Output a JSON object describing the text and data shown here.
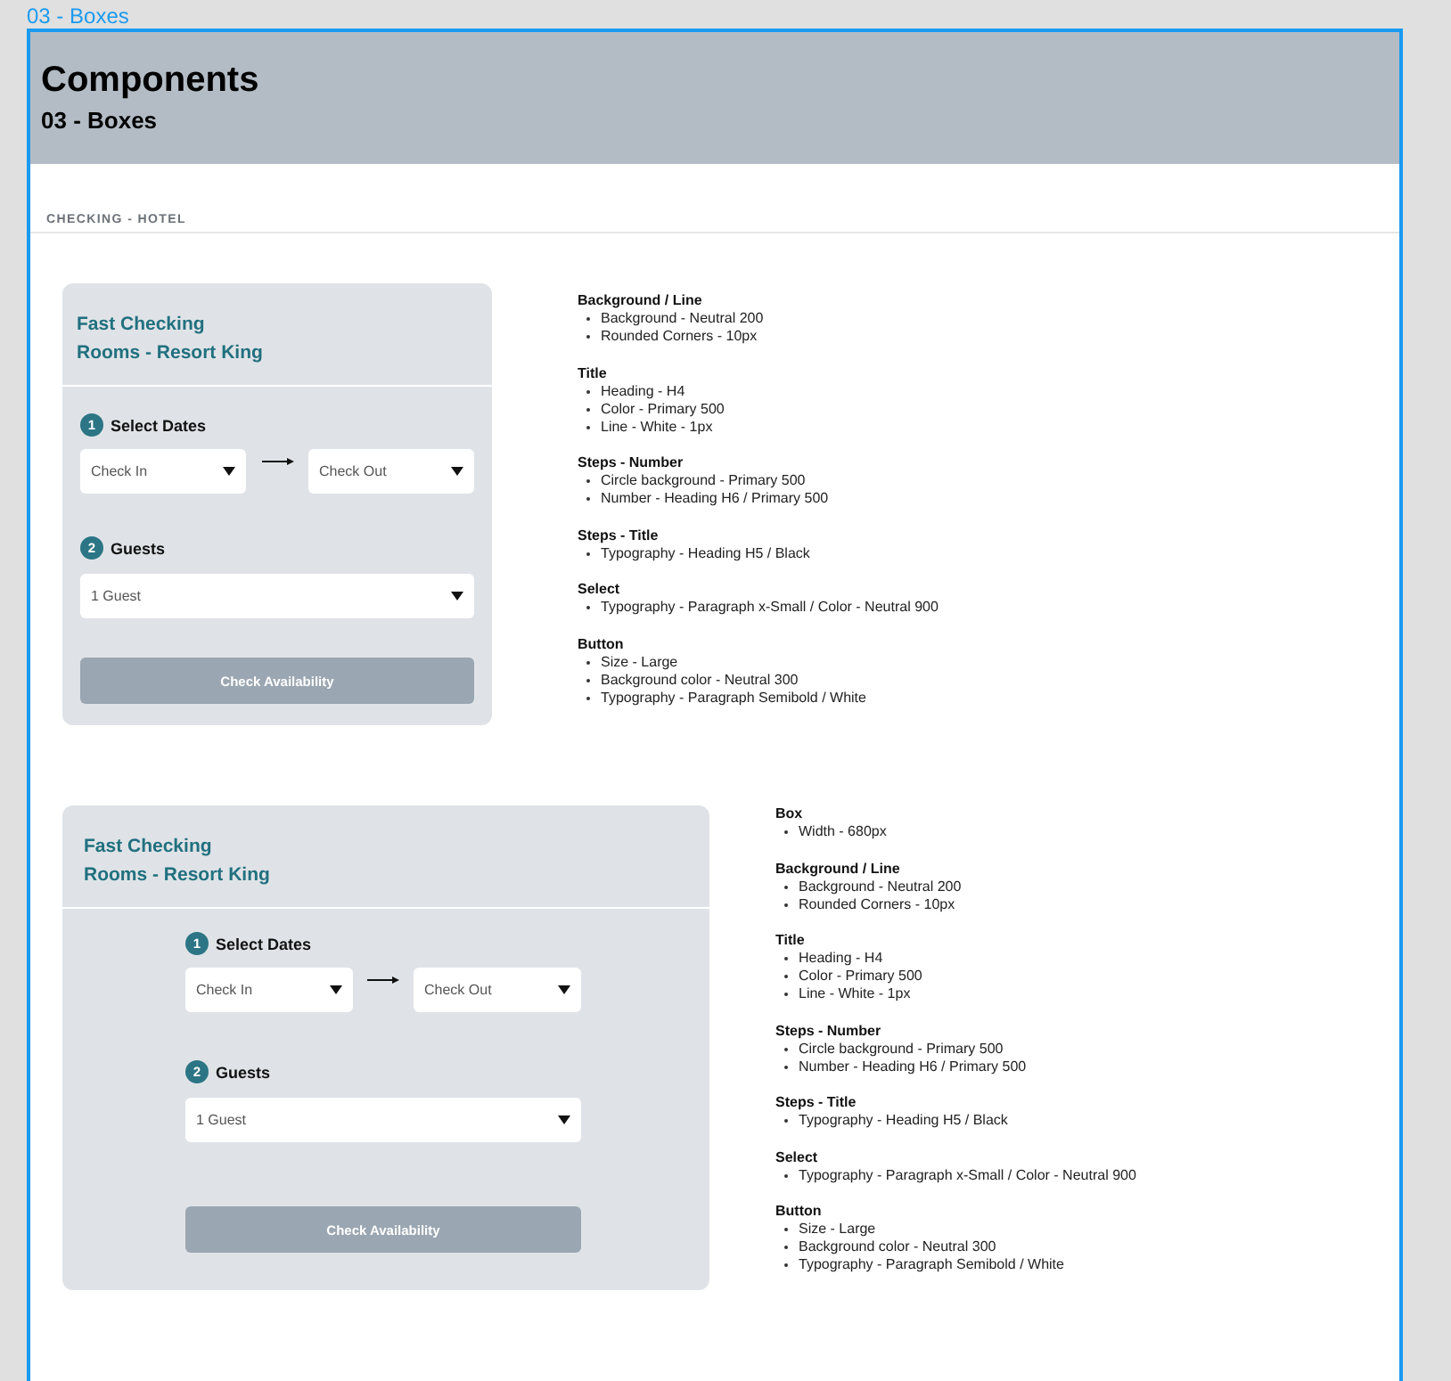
{
  "frame_label": "03 - Boxes",
  "header": {
    "title": "Components",
    "subtitle": "03 - Boxes"
  },
  "section_label": "CHECKING - HOTEL",
  "examples": [
    {
      "kind": "compact",
      "card": {
        "title": "Fast Checking",
        "subtitle": "Rooms - Resort King",
        "steps": [
          {
            "number": "1",
            "title": "Select Dates",
            "selects": [
              {
                "value": "Check In"
              },
              {
                "value": "Check Out"
              }
            ]
          },
          {
            "number": "2",
            "title": "Guests",
            "selects": [
              {
                "value": "1 Guest"
              }
            ]
          }
        ],
        "button": "Check Availability"
      },
      "specs": [
        {
          "heading": "Background / Line",
          "items": [
            "Background - Neutral 200",
            "Rounded Corners - 10px"
          ]
        },
        {
          "heading": "Title",
          "items": [
            "Heading - H4",
            "Color - Primary 500",
            "Line - White - 1px"
          ]
        },
        {
          "heading": "Steps - Number",
          "items": [
            "Circle background - Primary 500",
            "Number - Heading H6 / Primary 500"
          ]
        },
        {
          "heading": "Steps - Title",
          "items": [
            "Typography - Heading H5 / Black"
          ]
        },
        {
          "heading": "Select",
          "items": [
            "Typography - Paragraph x-Small / Color - Neutral 900"
          ]
        },
        {
          "heading": "Button",
          "items": [
            "Size - Large",
            "Background color - Neutral 300",
            "Typography - Paragraph Semibold / White"
          ]
        }
      ]
    },
    {
      "kind": "wide",
      "card": {
        "title": "Fast Checking",
        "subtitle": "Rooms - Resort King",
        "steps": [
          {
            "number": "1",
            "title": "Select Dates",
            "selects": [
              {
                "value": "Check In"
              },
              {
                "value": "Check Out"
              }
            ]
          },
          {
            "number": "2",
            "title": "Guests",
            "selects": [
              {
                "value": "1 Guest"
              }
            ]
          }
        ],
        "button": "Check Availability"
      },
      "specs": [
        {
          "heading": "Box",
          "items": [
            "Width - 680px"
          ]
        },
        {
          "heading": "Background / Line",
          "items": [
            "Background - Neutral 200",
            "Rounded Corners - 10px"
          ]
        },
        {
          "heading": "Title",
          "items": [
            "Heading - H4",
            "Color - Primary 500",
            "Line - White - 1px"
          ]
        },
        {
          "heading": "Steps - Number",
          "items": [
            "Circle background - Primary 500",
            "Number - Heading H6 / Primary 500"
          ]
        },
        {
          "heading": "Steps - Title",
          "items": [
            "Typography - Heading H5 / Black"
          ]
        },
        {
          "heading": "Select",
          "items": [
            "Typography - Paragraph x-Small / Color - Neutral 900"
          ]
        },
        {
          "heading": "Button",
          "items": [
            "Size - Large",
            "Background color - Neutral 300",
            "Typography - Paragraph Semibold / White"
          ]
        }
      ]
    }
  ]
}
